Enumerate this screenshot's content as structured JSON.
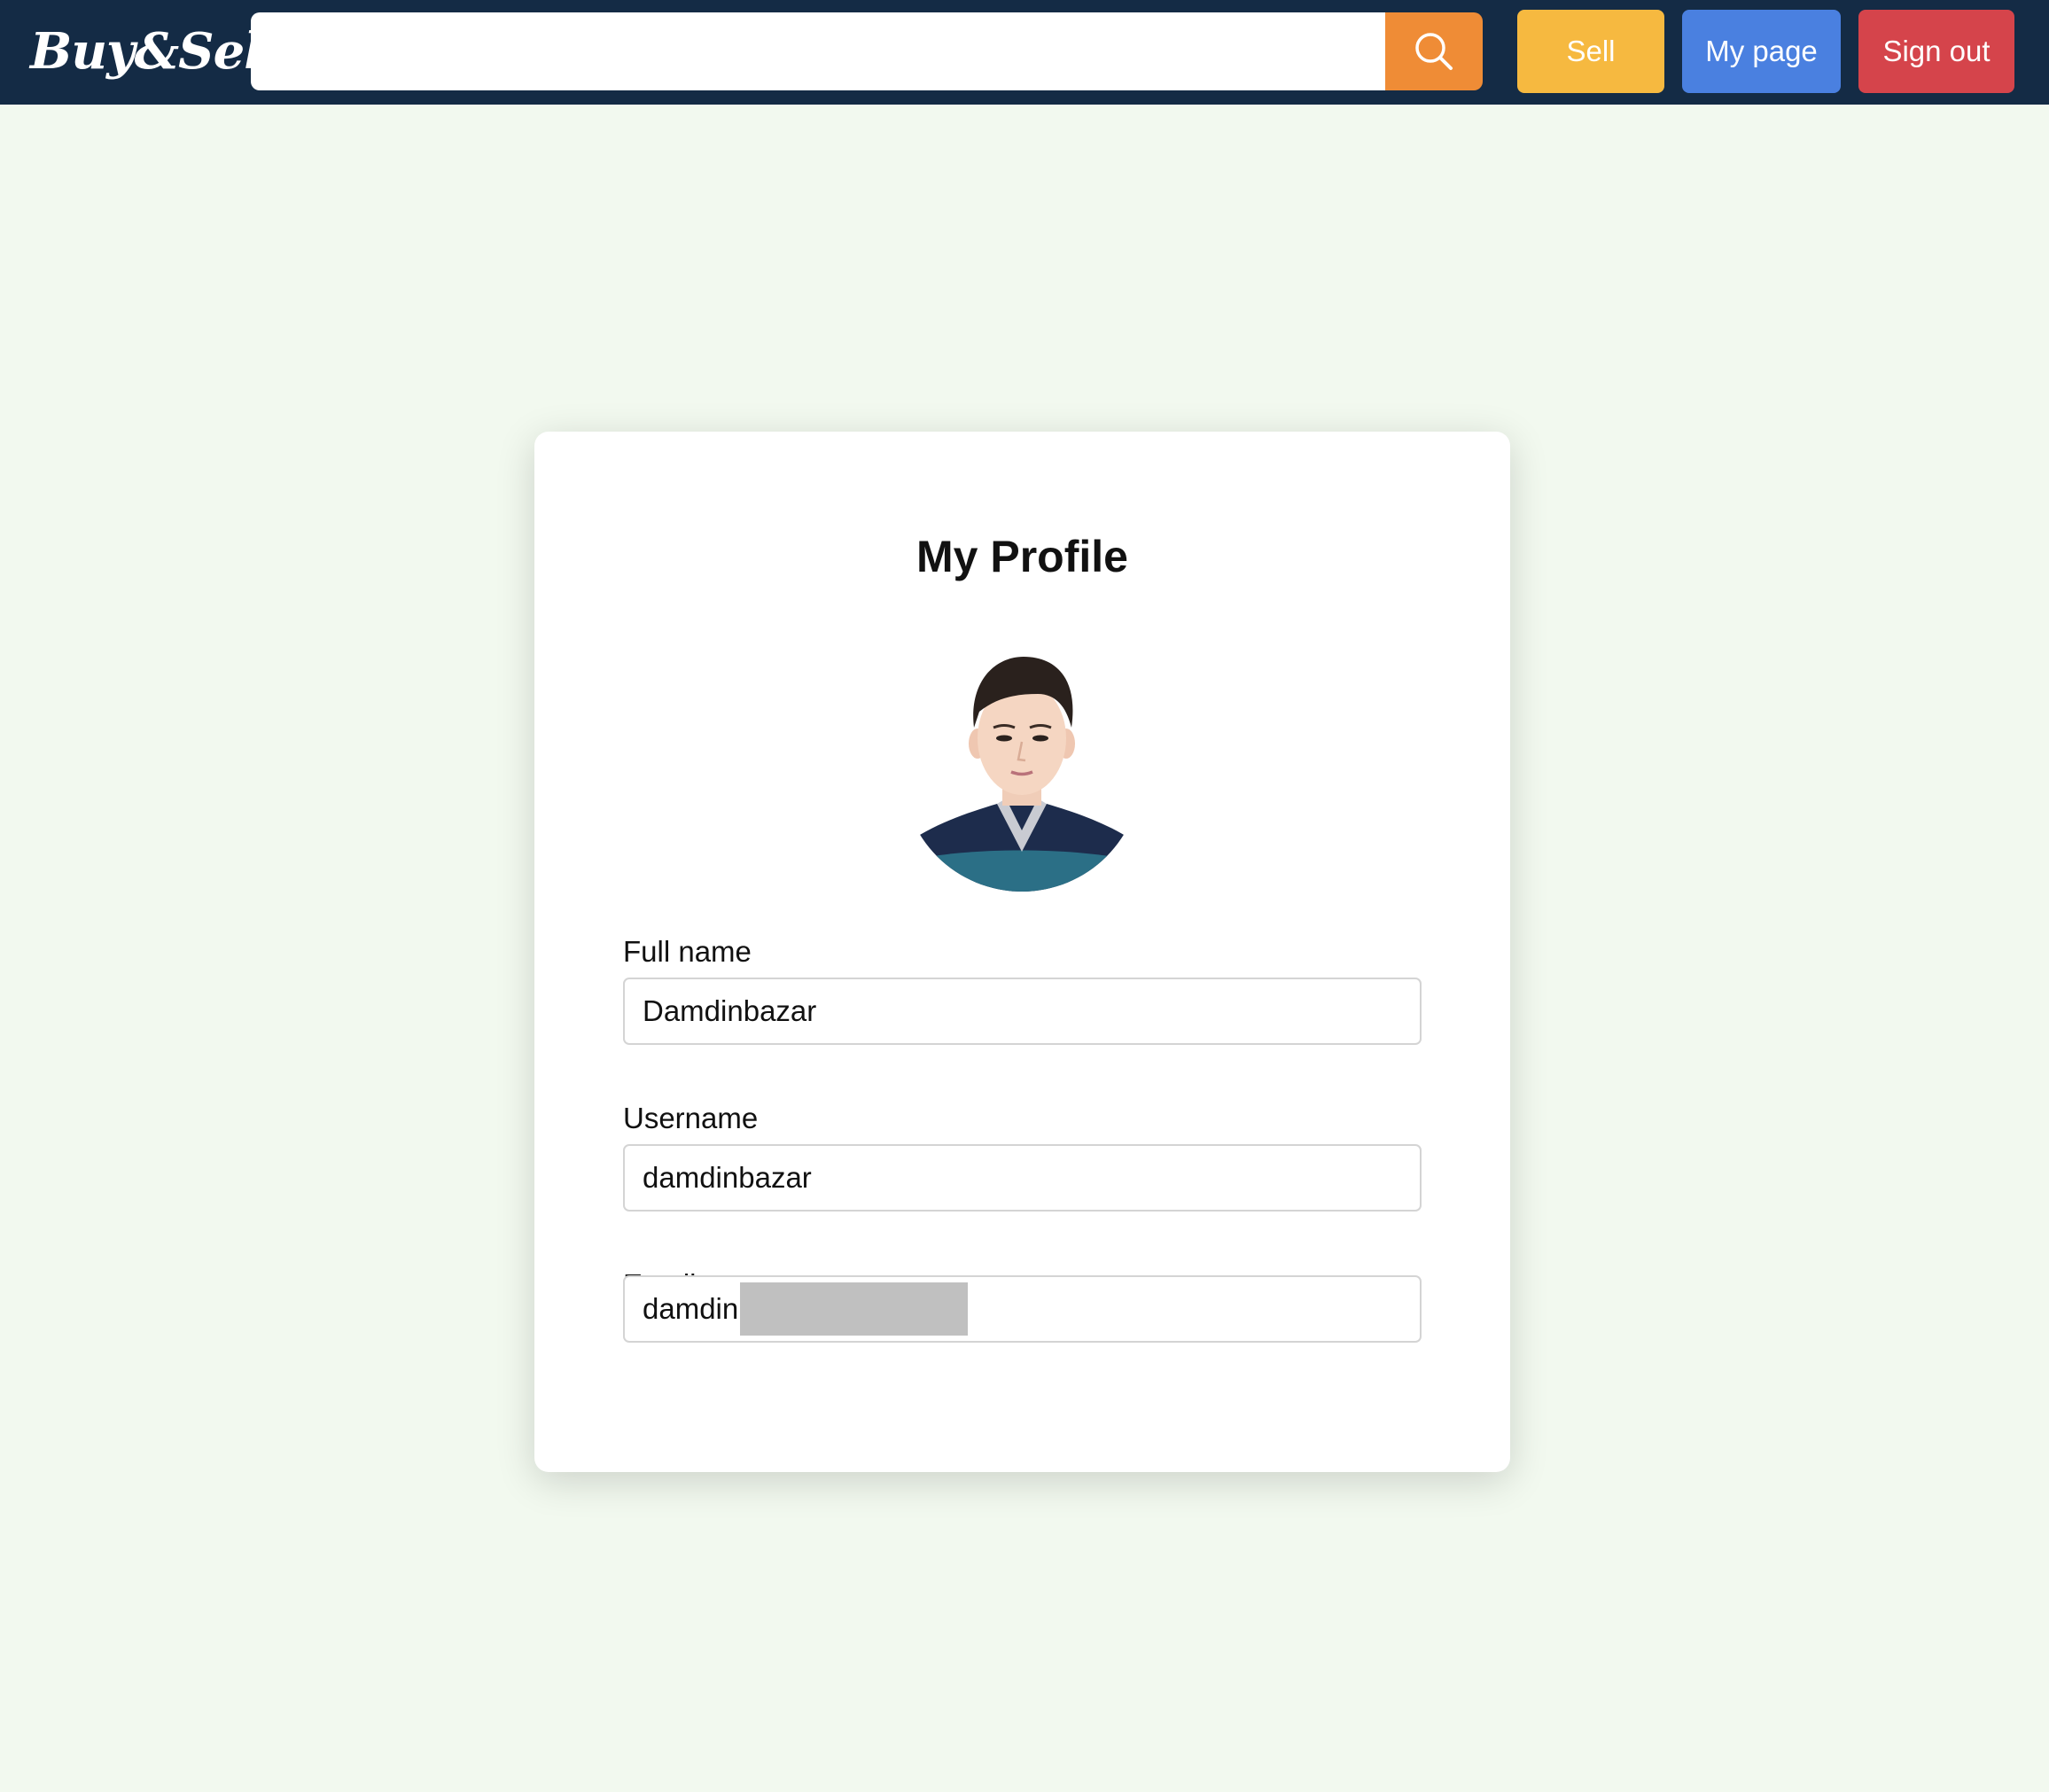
{
  "header": {
    "logo_text": "Buy&Sell",
    "search": {
      "value": "",
      "placeholder": ""
    },
    "buttons": {
      "sell": "Sell",
      "my_page": "My page",
      "sign_out": "Sign out"
    }
  },
  "profile": {
    "title": "My Profile",
    "fields": [
      {
        "label": "Full name",
        "value": "Damdinbazar"
      },
      {
        "label": "Username",
        "value": "damdinbazar"
      },
      {
        "label": "Email",
        "value": "damdin"
      }
    ]
  },
  "colors": {
    "navbar": "#142b45",
    "background": "#f2f9ef",
    "search_button": "#ef8c36",
    "sell": "#f6b940",
    "my_page": "#4a80e0",
    "sign_out": "#d5444b"
  }
}
